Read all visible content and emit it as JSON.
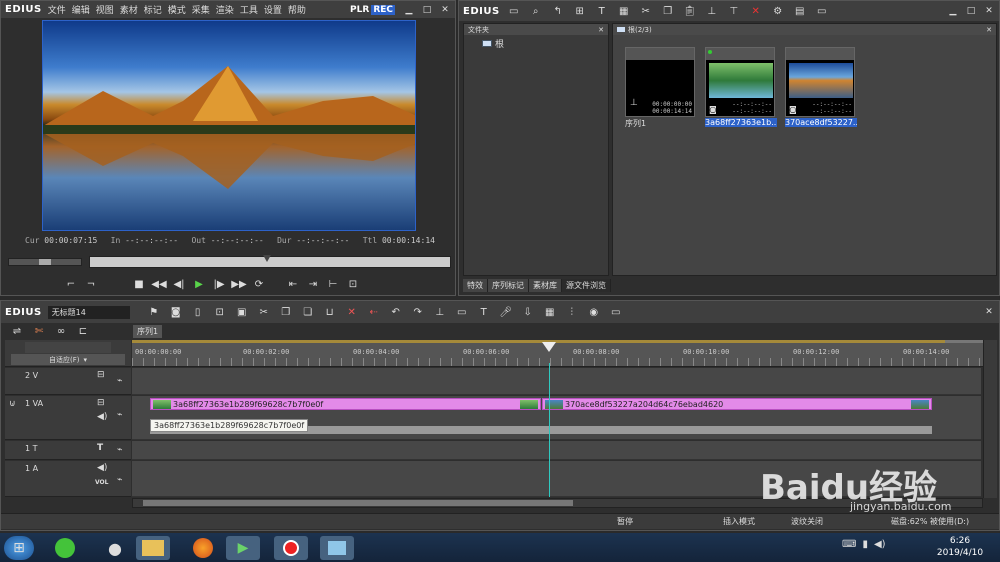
{
  "player": {
    "logo": "EDIUS",
    "menus": [
      "文件",
      "编辑",
      "视图",
      "素材",
      "标记",
      "模式",
      "采集",
      "渲染",
      "工具",
      "设置",
      "帮助"
    ],
    "plr": "PLR",
    "rec": "REC",
    "timecodes": {
      "cur_label": "Cur",
      "cur": "00:00:07:15",
      "in_label": "In",
      "in": "--:--:--:--",
      "out_label": "Out",
      "out": "--:--:--:--",
      "dur_label": "Dur",
      "dur": "--:--:--:--",
      "ttl_label": "Ttl",
      "ttl": "00:00:14:14"
    }
  },
  "bin": {
    "logo": "EDIUS",
    "folder_panel_title": "文件夹",
    "root_label": "根",
    "path_label": "根(2/3)",
    "items": [
      {
        "name": "序列1",
        "tc1": "00:00:00:00",
        "tc2": "00:00:14:14"
      },
      {
        "name": "3a68ff27363e1b...",
        "tc1": "--:--:--:--",
        "tc2": "--:--:--:--"
      },
      {
        "name": "370ace8df53227...",
        "tc1": "--:--:--:--",
        "tc2": "--:--:--:--"
      }
    ],
    "tabs": [
      "特效",
      "序列标记",
      "素材库",
      "源文件浏览"
    ]
  },
  "timeline": {
    "logo": "EDIUS",
    "project_name": "无标题14",
    "sequence_tab": "序列1",
    "fit_label": "自适应(F)",
    "ruler_labels": [
      "00:00:00:00",
      "00:00:02:00",
      "00:00:04:00",
      "00:00:06:00",
      "00:00:08:00",
      "00:00:10:00",
      "00:00:12:00",
      "00:00:14:00"
    ],
    "tracks": {
      "v2": "2 V",
      "va1": "1 VA",
      "t1": "1 T",
      "a1": "1 A",
      "vol": "VOL"
    },
    "clips": [
      {
        "name": "3a68ff27363e1b289f69628c7b7f0e0f"
      },
      {
        "name": "370ace8df53227a204d64c76ebad4620"
      }
    ],
    "tooltip": "3a68ff27363e1b289f69628c7b7f0e0f",
    "status": {
      "pause": "暂停",
      "insert_mode": "插入模式",
      "ripple": "波纹关闭",
      "disk": "磁盘:62% 被使用(D:)"
    }
  },
  "taskbar": {
    "time": "6:26",
    "date": "2019/4/10",
    "watermark": "Baidu经验",
    "watermark_url": "jingyan.baidu.com"
  }
}
